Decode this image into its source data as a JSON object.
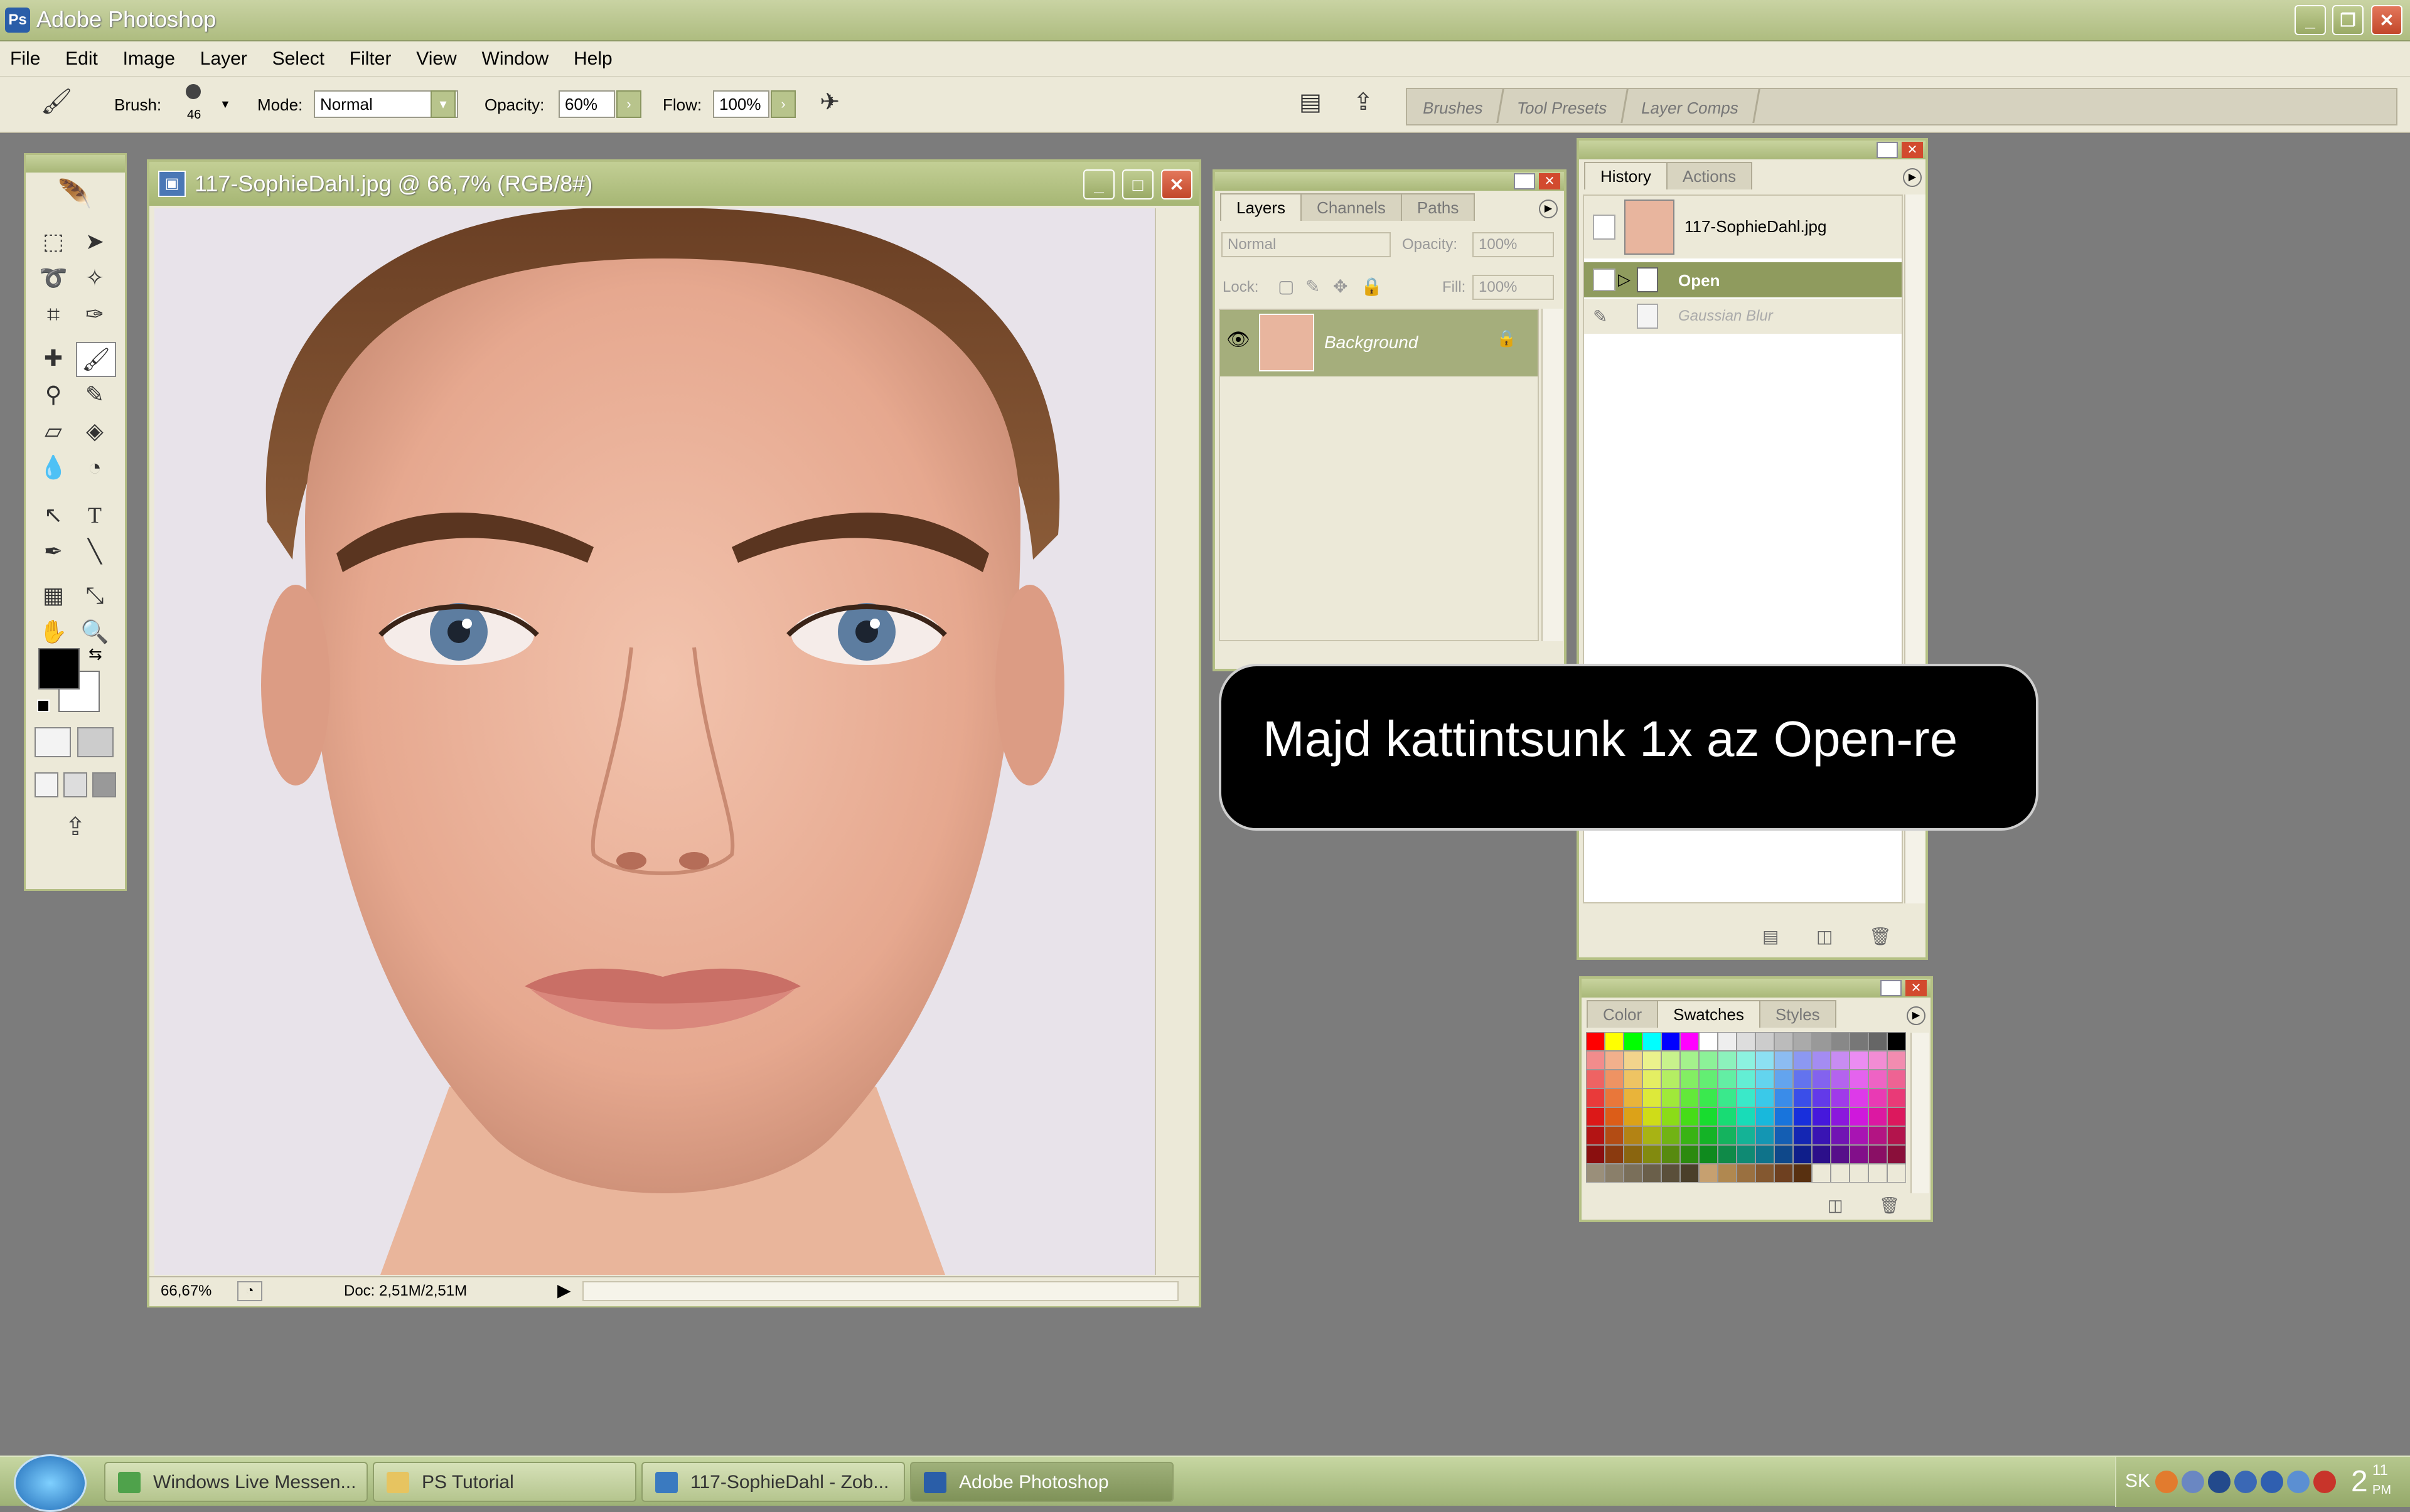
{
  "app": {
    "title": "Adobe Photoshop",
    "window_buttons": [
      "_",
      "❐",
      "✕"
    ]
  },
  "menu": [
    "File",
    "Edit",
    "Image",
    "Layer",
    "Select",
    "Filter",
    "View",
    "Window",
    "Help"
  ],
  "options": {
    "brush_label": "Brush:",
    "brush_size": "46",
    "mode_label": "Mode:",
    "mode_value": "Normal",
    "opacity_label": "Opacity:",
    "opacity_value": "60%",
    "flow_label": "Flow:",
    "flow_value": "100%"
  },
  "palette_well": [
    "Brushes",
    "Tool Presets",
    "Layer Comps"
  ],
  "document": {
    "title": "117-SophieDahl.jpg @ 66,7% (RGB/8#)",
    "zoom": "66,67%",
    "doc_size": "Doc: 2,51M/2,51M"
  },
  "layers_panel": {
    "tabs": [
      "Layers",
      "Channels",
      "Paths"
    ],
    "blend_mode": "Normal",
    "opacity_label": "Opacity:",
    "opacity_value": "100%",
    "lock_label": "Lock:",
    "fill_label": "Fill:",
    "fill_value": "100%",
    "layer_name": "Background"
  },
  "history_panel": {
    "tabs": [
      "History",
      "Actions"
    ],
    "snapshot": "117-SophieDahl.jpg",
    "states": [
      "Open",
      "Gaussian Blur"
    ]
  },
  "swatches_panel": {
    "tabs": [
      "Color",
      "Swatches",
      "Styles"
    ]
  },
  "callout": {
    "text": "Majd kattintsunk 1x az Open-re"
  },
  "taskbar": {
    "items": [
      "Windows Live Messen...",
      "PS Tutorial",
      "117-SophieDahl - Zob...",
      "Adobe Photoshop"
    ],
    "lang": "SK",
    "time": "2",
    "time_small": "11",
    "time_ampm": "PM"
  },
  "colors": {
    "chrome_green": "#aebc80",
    "panel_bg": "#ece9d8",
    "workspace": "#7c7c7c",
    "history_selected": "#8f9b5e",
    "layer_selected": "#a5ae7c"
  }
}
